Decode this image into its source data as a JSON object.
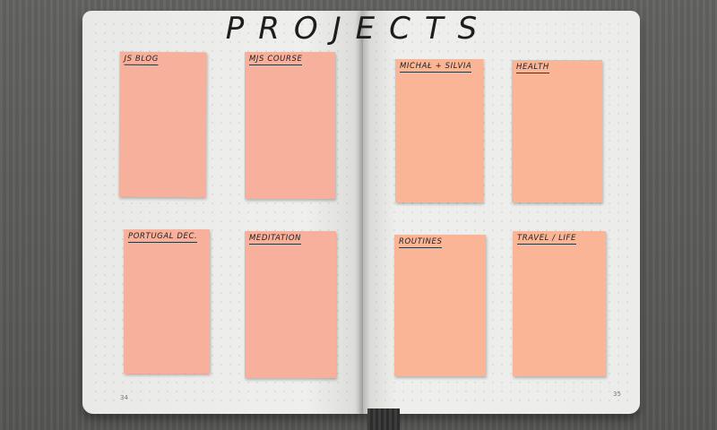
{
  "heading": "PROJECTS",
  "notes": [
    {
      "label": "JS BLOG"
    },
    {
      "label": "MJS COURSE"
    },
    {
      "label": "MICHAŁ + SILVIA"
    },
    {
      "label": "HEALTH"
    },
    {
      "label": "PORTUGAL DEC."
    },
    {
      "label": "MEDITATION"
    },
    {
      "label": "ROUTINES"
    },
    {
      "label": "TRAVEL / LIFE"
    }
  ],
  "page_numbers": {
    "left": "34",
    "right": "35"
  },
  "colors": {
    "note_pink": "#f7b09c",
    "note_peach": "#f9b595",
    "paper": "#ececea",
    "ink": "#1d1d1d",
    "table": "#5a5a58"
  }
}
